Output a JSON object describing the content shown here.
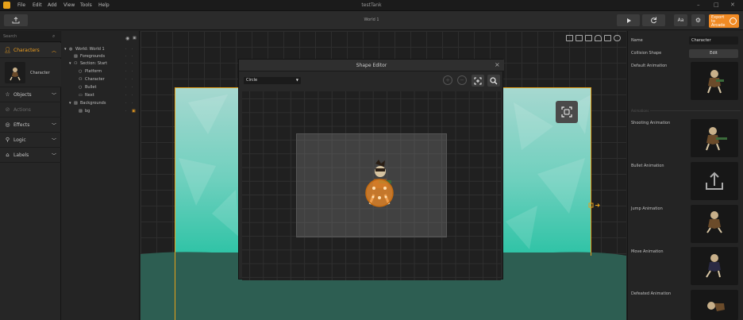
{
  "menubar": {
    "items": [
      "File",
      "Edit",
      "Add",
      "View",
      "Tools",
      "Help"
    ],
    "title": "testTank"
  },
  "toolbar": {
    "title": "World 1",
    "font_button": "Aa",
    "export_label": "Export to Arcade"
  },
  "left_panel": {
    "search_placeholder": "Search",
    "sections": [
      {
        "label": "Characters",
        "icon": "person-icon",
        "active": true
      },
      {
        "label": "Objects",
        "icon": "star-icon"
      },
      {
        "label": "Actions",
        "icon": "actions-icon",
        "disabled": true
      },
      {
        "label": "Effects",
        "icon": "effects-icon"
      },
      {
        "label": "Logic",
        "icon": "logic-icon"
      },
      {
        "label": "Labels",
        "icon": "tag-icon"
      }
    ],
    "character_item": "Character"
  },
  "hierarchy": {
    "rows": [
      {
        "label": "World: World 1",
        "icon": "world-icon"
      },
      {
        "label": "Foregrounds",
        "icon": "image-icon"
      },
      {
        "label": "Section: Start",
        "icon": "person-icon"
      },
      {
        "label": "Platform",
        "icon": "circle-icon"
      },
      {
        "label": "Character",
        "icon": "person-icon"
      },
      {
        "label": "Bullet",
        "icon": "circle-icon"
      },
      {
        "label": "Next",
        "icon": "rect-icon"
      },
      {
        "label": "Backgrounds",
        "icon": "image-icon"
      },
      {
        "label": "bg",
        "icon": "image-icon",
        "locked": true
      }
    ]
  },
  "dialog": {
    "title": "Shape Editor",
    "shape_select": "Circle"
  },
  "right_panel": {
    "name_label": "Name",
    "name_value": "Character",
    "collision_label": "Collision Shape",
    "edit_button": "Edit",
    "animations_header": "Animations",
    "animations": [
      "Default Animation",
      "Shooting Animation",
      "Bullet Animation",
      "Jump Animation",
      "Move Animation",
      "Defeated Animation"
    ]
  },
  "colors": {
    "accent": "#f08a24",
    "selection": "#e8a21a",
    "teal": "#3dc8b0",
    "ground": "#2d5e52"
  }
}
